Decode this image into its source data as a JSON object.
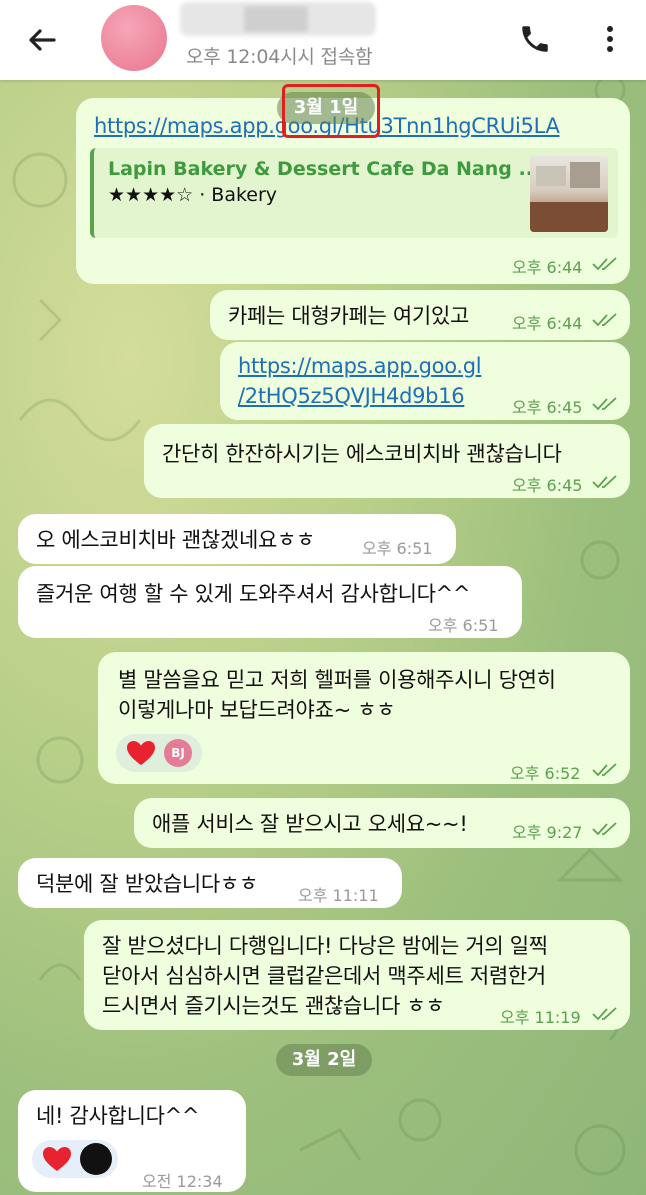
{
  "header": {
    "status": "오후 12:04시시 접속함"
  },
  "dates": {
    "march1": "3월 1일",
    "march2": "3월 2일"
  },
  "messages": [
    {
      "text": "https://maps.app.goo.gl/Htu3Tnn1hgCRUi5LA",
      "time": "오후 6:44"
    },
    {
      "text": "카페는 대형카페는 여기있고",
      "time": "오후 6:44"
    },
    {
      "line1": "https://maps.app.goo.gl",
      "line2": "/2tHQ5z5QVJH4d9b16",
      "time": "오후 6:45"
    },
    {
      "text": "간단히 한잔하시기는 에스코비치바 괜찮습니다",
      "time": "오후 6:45"
    },
    {
      "text": "오 에스코비치바 괜찮겠네요ㅎㅎ",
      "time": "오후 6:51"
    },
    {
      "text": "즐거운 여행 할 수 있게 도와주셔서 감사합니다^^",
      "time": "오후 6:51"
    },
    {
      "line1": "별 말씀을요 믿고 저희 헬퍼를 이용해주시니 당연히",
      "line2": "이렇게나마 보답드려야죠~ ㅎㅎ",
      "time": "오후 6:52"
    },
    {
      "text": "애플 서비스 잘 받으시고 오세요~~!",
      "time": "오후 9:27"
    },
    {
      "text": "덕분에 잘 받았습니다ㅎㅎ",
      "time": "오후 11:11"
    },
    {
      "line1": "잘 받으셨다니 다행입니다! 다낭은 밤에는 거의 일찍",
      "line2": "닫아서 심심하시면 클럽같은데서 맥주세트 저렴한거",
      "line3": "드시면서 즐기시는것도 괜찮습니다 ㅎㅎ",
      "time": "오후 11:19"
    },
    {
      "text": "네! 감사합니다^^",
      "time": "오전 12:34"
    }
  ],
  "link_preview": {
    "title": "Lapin Bakery & Dessert Cafe Da Nang ...",
    "subtitle": "★★★★☆ · Bakery"
  },
  "reactions": {
    "avatar_initials": "BJ"
  },
  "colors": {
    "outgoing_bubble": "#effedd",
    "time_green": "#5aa24e",
    "link_blue": "#1e6fb7",
    "highlight_red": "#e0201e"
  }
}
